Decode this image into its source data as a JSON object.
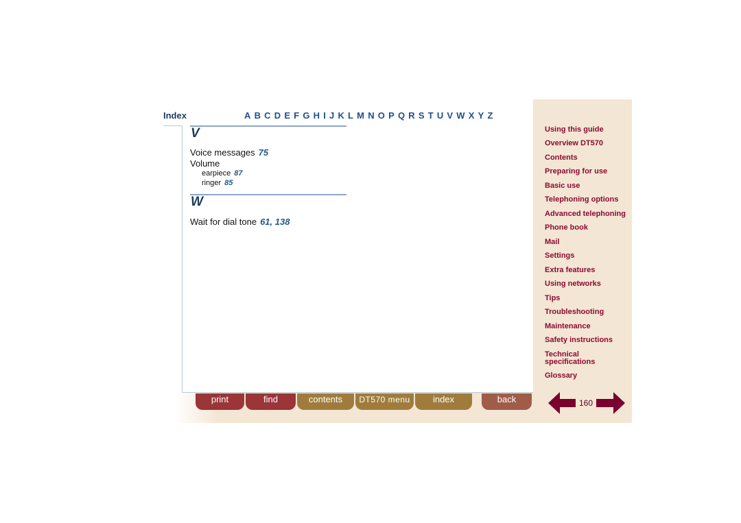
{
  "header": {
    "title": "Index",
    "letters": [
      "A",
      "B",
      "C",
      "D",
      "E",
      "F",
      "G",
      "H",
      "I",
      "J",
      "K",
      "L",
      "M",
      "N",
      "O",
      "P",
      "Q",
      "R",
      "S",
      "T",
      "U",
      "V",
      "W",
      "X",
      "Y",
      "Z"
    ]
  },
  "sections": [
    {
      "letter": "V",
      "entries": [
        {
          "text": "Voice messages",
          "pages": "75"
        },
        {
          "text": "Volume",
          "pages": ""
        },
        {
          "text": "earpiece",
          "pages": "87",
          "sub": true
        },
        {
          "text": "ringer",
          "pages": "85",
          "sub": true
        }
      ]
    },
    {
      "letter": "W",
      "entries": [
        {
          "text": "Wait for dial tone",
          "pages": "61, 138"
        }
      ]
    }
  ],
  "sidebar": [
    "Using this guide",
    "Overview DT570",
    "Contents",
    "Preparing for use",
    "Basic use",
    "Telephoning options",
    "Advanced telephoning",
    "Phone book",
    "Mail",
    "Settings",
    "Extra features",
    "Using networks",
    "Tips",
    "Troubleshooting",
    "Maintenance",
    "Safety instructions",
    "Technical specifications",
    "Glossary"
  ],
  "buttons": {
    "print": "print",
    "find": "find",
    "contents": "contents",
    "menu": "DT570 menu",
    "index": "index",
    "back": "back"
  },
  "page_number": "160",
  "colors": {
    "nav": "#8b0a30",
    "link": "#1f5a8a",
    "arrow": "#7a0030"
  }
}
